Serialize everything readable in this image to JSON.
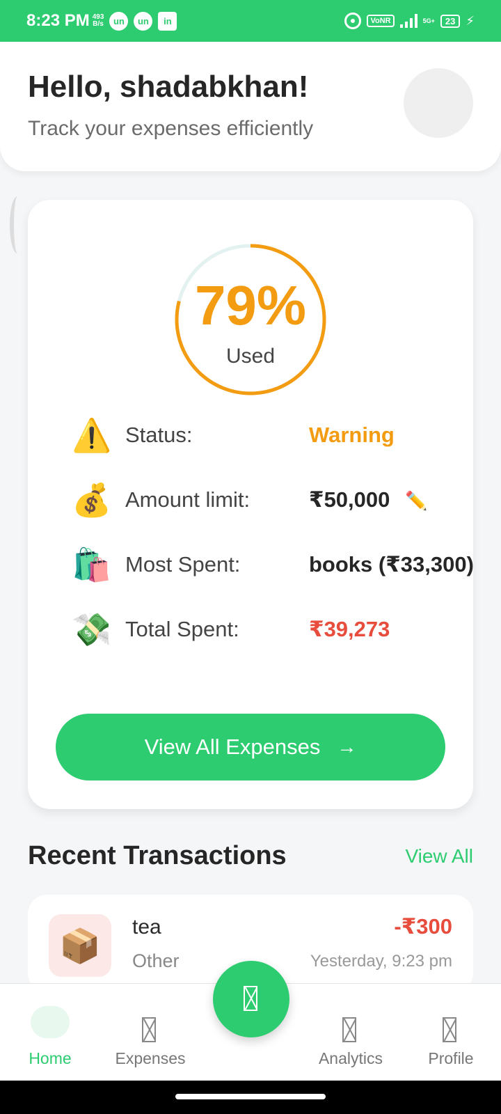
{
  "status_bar": {
    "time": "8:23 PM",
    "speed_value": "493",
    "speed_unit": "B/s",
    "apps": [
      "un",
      "un",
      "in"
    ],
    "vonr": "VoNR",
    "network": "5G+",
    "battery": "23"
  },
  "header": {
    "greeting": "Hello, shadabkhan!",
    "subtitle": "Track your expenses efficiently"
  },
  "summary": {
    "percent_used": 79,
    "percent_label": "79%",
    "used_label": "Used",
    "gauge_color": "#f39c12",
    "track_color": "#e3f2f1",
    "rows": [
      {
        "icon": "warning-icon",
        "emoji": "⚠️",
        "label": "Status:",
        "value": "Warning"
      },
      {
        "icon": "money-bag-icon",
        "emoji": "💰",
        "label": "Amount limit:",
        "value": "₹50,000"
      },
      {
        "icon": "shopping-bags-icon",
        "emoji": "🛍️",
        "label": "Most Spent:",
        "value": "books (₹33,300)"
      },
      {
        "icon": "money-wings-icon",
        "emoji": "💸",
        "label": "Total Spent:",
        "value": "₹39,273"
      }
    ],
    "edit_icon": "✏️",
    "view_all_button": "View All Expenses",
    "view_all_arrow": "→"
  },
  "recent": {
    "title": "Recent Transactions",
    "view_all": "View All",
    "transactions": [
      {
        "icon": "package-icon",
        "emoji": "📦",
        "name": "tea",
        "category": "Other",
        "amount": "-₹300",
        "time": "Yesterday, 9:23 pm"
      }
    ]
  },
  "nav": {
    "items": [
      {
        "label": "Home",
        "active": true
      },
      {
        "label": "Expenses",
        "active": false
      },
      {
        "label": "Analytics",
        "active": false
      },
      {
        "label": "Profile",
        "active": false
      }
    ]
  },
  "colors": {
    "accent": "#2ecc71",
    "warning": "#f39c12",
    "danger": "#e74c3c"
  }
}
